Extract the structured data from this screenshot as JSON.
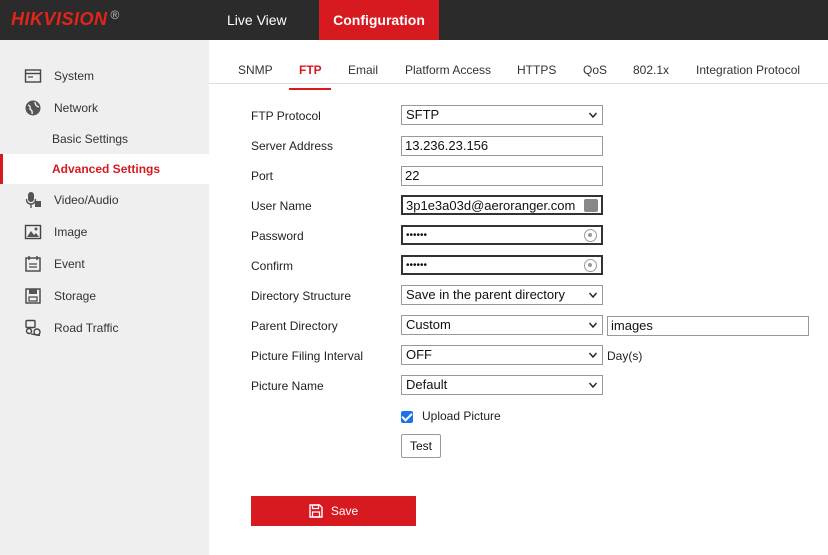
{
  "header": {
    "logo": "HIKVISION",
    "logo_mark": "®",
    "nav": [
      {
        "label": "Live View"
      },
      {
        "label": "Configuration",
        "active": true
      }
    ]
  },
  "sidebar": {
    "items": [
      {
        "label": "System",
        "icon": "system-icon"
      },
      {
        "label": "Network",
        "icon": "network-icon"
      },
      {
        "label": "Basic Settings",
        "sub": true
      },
      {
        "label": "Advanced Settings",
        "sub": true,
        "active": true
      },
      {
        "label": "Video/Audio",
        "icon": "video-audio-icon"
      },
      {
        "label": "Image",
        "icon": "image-icon"
      },
      {
        "label": "Event",
        "icon": "event-icon"
      },
      {
        "label": "Storage",
        "icon": "storage-icon"
      },
      {
        "label": "Road Traffic",
        "icon": "road-traffic-icon"
      }
    ]
  },
  "tabs": [
    {
      "label": "SNMP"
    },
    {
      "label": "FTP",
      "active": true
    },
    {
      "label": "Email"
    },
    {
      "label": "Platform Access"
    },
    {
      "label": "HTTPS"
    },
    {
      "label": "QoS"
    },
    {
      "label": "802.1x"
    },
    {
      "label": "Integration Protocol"
    }
  ],
  "form": {
    "ftp_protocol": {
      "label": "FTP Protocol",
      "value": "SFTP"
    },
    "server_address": {
      "label": "Server Address",
      "value": "13.236.23.156"
    },
    "port": {
      "label": "Port",
      "value": "22"
    },
    "user_name": {
      "label": "User Name",
      "value": "3p1e3a03d@aeroranger.com"
    },
    "password": {
      "label": "Password",
      "value": "••••••"
    },
    "confirm": {
      "label": "Confirm",
      "value": "••••••"
    },
    "directory_structure": {
      "label": "Directory Structure",
      "value": "Save in the parent directory"
    },
    "parent_directory": {
      "label": "Parent Directory",
      "value": "Custom",
      "custom_value": "images"
    },
    "picture_filing_interval": {
      "label": "Picture Filing Interval",
      "value": "OFF",
      "unit": "Day(s)"
    },
    "picture_name": {
      "label": "Picture Name",
      "value": "Default"
    },
    "upload_picture": {
      "label": "Upload Picture",
      "checked": true
    },
    "test_label": "Test",
    "save_label": "Save"
  },
  "colors": {
    "accent": "#d71920",
    "header_bg": "#2b2b2b",
    "sidebar_bg": "#efefef",
    "checkbox": "#1a73e8"
  }
}
